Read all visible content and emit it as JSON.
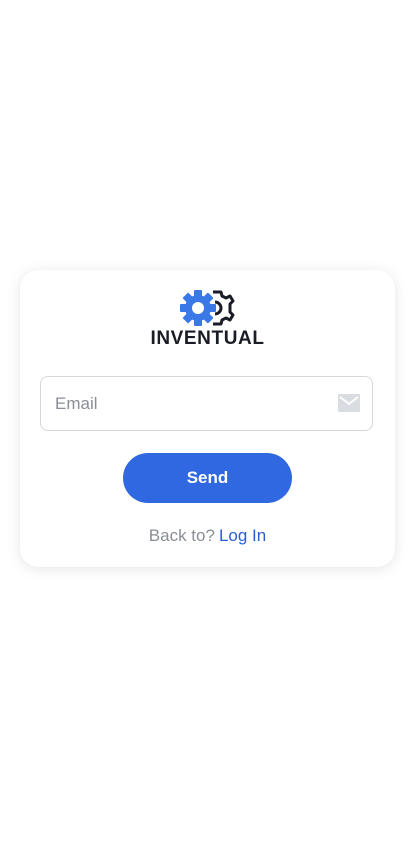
{
  "brand": {
    "name": "INVENTUAL",
    "logo_icon": "gears-icon",
    "colors": {
      "primary": "#2f68e0",
      "logo_blue": "#3b78e7",
      "logo_dark": "#1a1d26"
    }
  },
  "form": {
    "email": {
      "placeholder": "Email",
      "value": "",
      "icon": "mail-icon"
    },
    "send_label": "Send"
  },
  "footer": {
    "back_text": "Back to?",
    "login_label": "Log In"
  }
}
